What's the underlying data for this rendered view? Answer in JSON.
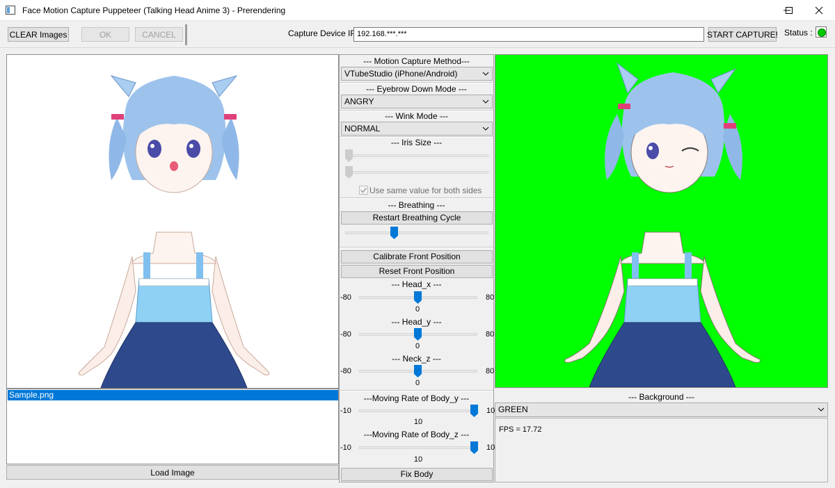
{
  "window": {
    "title": "Face Motion Capture Puppeteer (Talking Head Anime 3) - Prerendering",
    "app_icon": "window-app-icon",
    "controls": [
      "minimize-icon",
      "maximize-icon",
      "close-icon"
    ]
  },
  "toolbar": {
    "clear_images": "CLEAR Images",
    "ok": "OK",
    "cancel": "CANCEL",
    "capture_ip_label": "Capture Device IP:",
    "capture_ip_value": "192.168.***.***",
    "start_capture": "START CAPTURE!",
    "status_label": "Status :",
    "status_color": "#00c800"
  },
  "left": {
    "images": [
      "Sample.png"
    ],
    "load_image": "Load Image"
  },
  "controls": {
    "motion_method_title": "--- Motion Capture Method---",
    "motion_method_value": "VTubeStudio (iPhone/Android)",
    "eyebrow_title": "--- Eyebrow Down Mode ---",
    "eyebrow_value": "ANGRY",
    "wink_title": "--- Wink Mode ---",
    "wink_value": "NORMAL",
    "iris_title": "--- Iris Size ---",
    "iris_same": "Use same value for both sides",
    "breathing_title": "--- Breathing ---",
    "restart_breathing": "Restart Breathing Cycle",
    "calibrate_front": "Calibrate Front Position",
    "reset_front": "Reset Front Position",
    "head_x_title": "--- Head_x ---",
    "head_y_title": "--- Head_y ---",
    "neck_z_title": "--- Neck_z ---",
    "head_min": "-80",
    "head_max": "80",
    "head_x_value": "0",
    "head_y_value": "0",
    "neck_z_value": "0",
    "body_y_title": "---Moving Rate of Body_y ---",
    "body_z_title": "---Moving Rate of Body_z ---",
    "body_min": "-10",
    "body_max": "10",
    "body_y_value": "10",
    "body_z_value": "10",
    "fix_body": "Fix Body"
  },
  "right": {
    "background_title": "--- Background ---",
    "background_value": "GREEN",
    "background_color": "#00ff00",
    "fps": "FPS = 17.72"
  },
  "colors": {
    "accent": "#0078d7",
    "slider_thumb": "#0078d7"
  }
}
